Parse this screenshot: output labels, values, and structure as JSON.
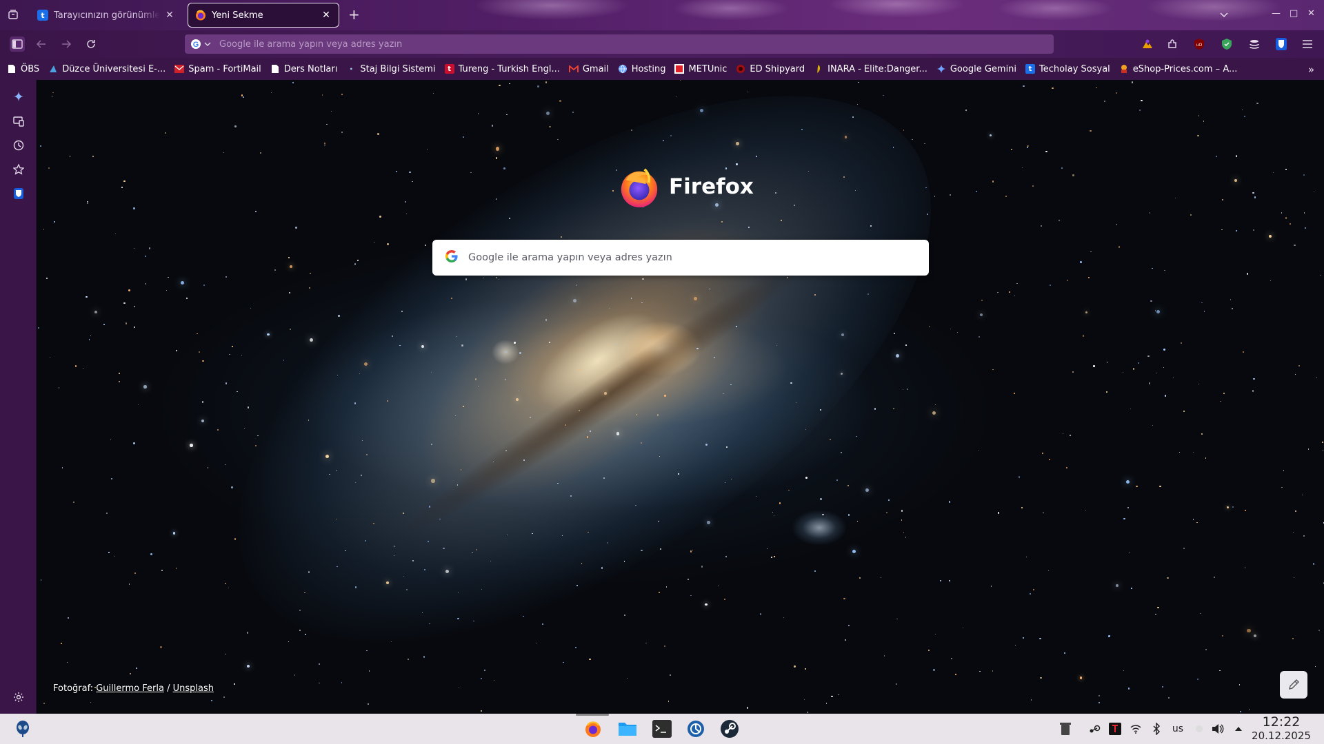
{
  "tabs": [
    {
      "title": "Tarayıcınızın görünümlerini",
      "favicon_letter": "t",
      "favicon_color": "#1a6ee8"
    },
    {
      "title": "Yeni Sekme",
      "favicon": "firefox-icon"
    }
  ],
  "toolbar": {
    "url_placeholder": "Google ile arama yapın veya adres yazın"
  },
  "bookmarks": [
    {
      "label": "ÖBS",
      "icon": "page-icon",
      "color": "#ffffff"
    },
    {
      "label": "Düzce Üniversitesi E-...",
      "icon": "duzce-icon",
      "color": "#4aa3e0"
    },
    {
      "label": "Spam - FortiMail",
      "icon": "fortimail-icon",
      "color": "#d0202a"
    },
    {
      "label": "Ders Notları",
      "icon": "page-icon",
      "color": "#ffffff"
    },
    {
      "label": "Staj Bilgi Sistemi",
      "icon": "staj-icon",
      "color": "#9cc4e8"
    },
    {
      "label": "Tureng - Turkish Engl...",
      "icon": "tureng-icon",
      "color": "#c8102e"
    },
    {
      "label": "Gmail",
      "icon": "gmail-icon",
      "color": "#ea4335"
    },
    {
      "label": "Hosting",
      "icon": "globe-icon",
      "color": "#6aa5ff"
    },
    {
      "label": "METUnic",
      "icon": "metunic-icon",
      "color": "#e0202a"
    },
    {
      "label": "ED Shipyard",
      "icon": "edshipyard-icon",
      "color": "#a01010"
    },
    {
      "label": "INARA - Elite:Danger...",
      "icon": "inara-icon",
      "color": "#d8b000"
    },
    {
      "label": "Google Gemini",
      "icon": "gemini-icon",
      "color": "#6fa3ff"
    },
    {
      "label": "Techolay Sosyal",
      "icon": "techolay-icon",
      "color": "#1a6ee8"
    },
    {
      "label": "eShop-Prices.com – A...",
      "icon": "eshop-icon",
      "color": "#f0a020"
    }
  ],
  "newtab": {
    "brand": "Firefox",
    "search_placeholder": "Google ile arama yapın veya adres yazın",
    "attribution_prefix": "Fotoğraf:",
    "photographer": "Guillermo Ferla",
    "separator": "/",
    "source": "Unsplash"
  },
  "taskbar": {
    "keyboard_layout": "us",
    "time": "12:22",
    "date": "20.12.2025"
  },
  "colors": {
    "accent": "#3a1548",
    "urlbar": "#6b3a7e",
    "taskbar": "#e9e4ea"
  }
}
